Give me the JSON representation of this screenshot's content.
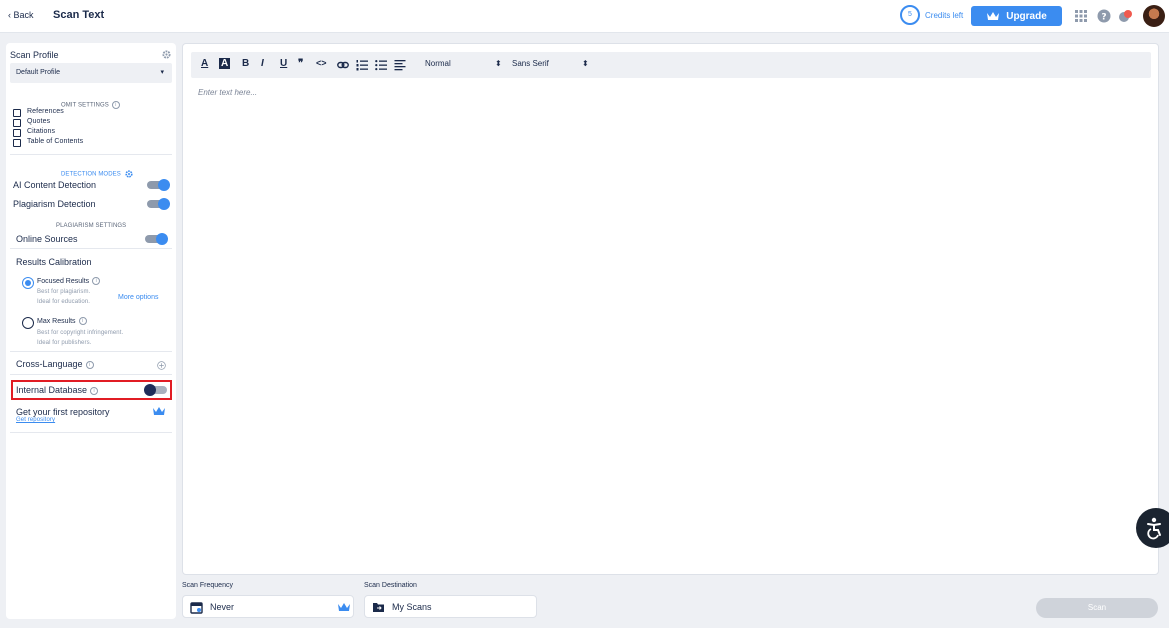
{
  "header": {
    "back_label": "Back",
    "title": "Scan Text",
    "credits_count": "5",
    "credits_label": "Credits left",
    "upgrade_label": "Upgrade"
  },
  "sidebar": {
    "scan_profile_label": "Scan Profile",
    "profile_value": "Default Profile",
    "omit_settings_heading": "OMIT SETTINGS",
    "omit_items": [
      "References",
      "Quotes",
      "Citations",
      "Table of Contents"
    ],
    "detection_modes_heading": "DETECTION MODES",
    "ai_detection_label": "AI Content Detection",
    "plagiarism_detection_label": "Plagiarism Detection",
    "plagiarism_settings_heading": "PLAGIARISM SETTINGS",
    "online_sources_label": "Online Sources",
    "results_calibration_label": "Results Calibration",
    "focused_title": "Focused Results",
    "focused_desc1": "Best for plagiarism.",
    "focused_desc2": "Ideal for education.",
    "more_options": "More options",
    "max_title": "Max Results",
    "max_desc1": "Best for copyright infringement.",
    "max_desc2": "Ideal for publishers.",
    "cross_language_label": "Cross-Language",
    "internal_db_label": "Internal Database",
    "repo_title": "Get your first repository",
    "repo_link": "Get repository",
    "toggles": {
      "ai_detection": true,
      "plagiarism_detection": true,
      "online_sources": true,
      "internal_database": false
    },
    "selected_calibration": "Focused Results"
  },
  "editor": {
    "format_value": "Normal",
    "font_value": "Sans Serif",
    "placeholder": "Enter text here..."
  },
  "bottom": {
    "frequency_label": "Scan Frequency",
    "frequency_value": "Never",
    "destination_label": "Scan Destination",
    "destination_value": "My Scans",
    "scan_label": "Scan"
  },
  "colors": {
    "accent": "#3b8cf0",
    "navy": "#1b2a4a",
    "highlight": "#e11c24"
  }
}
